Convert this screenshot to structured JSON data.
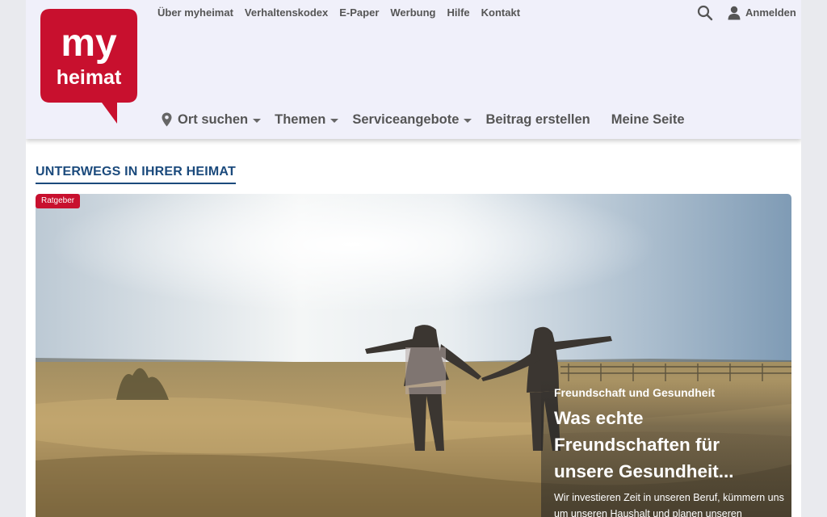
{
  "logo": {
    "line1": "my",
    "line2": "heimat",
    "color": "#c8102e"
  },
  "top_nav": {
    "links": [
      "Über myheimat",
      "Verhaltenskodex",
      "E-Paper",
      "Werbung",
      "Hilfe",
      "Kontakt"
    ],
    "search_icon": "search-icon",
    "login_label": "Anmelden",
    "login_icon": "user-icon"
  },
  "main_nav": {
    "location": {
      "label": "Ort suchen",
      "icon": "map-pin-icon"
    },
    "themes": "Themen",
    "services": "Serviceangebote",
    "create_post": "Beitrag erstellen",
    "my_page": "Meine Seite"
  },
  "section": {
    "title": "UNTERWEGS IN IHRER HEIMAT"
  },
  "hero": {
    "badge": "Ratgeber",
    "category": "Freundschaft und Gesundheit",
    "title": "Was echte Freundschaften für unsere Gesundheit...",
    "description": "Wir investieren Zeit in unseren Beruf, kümmern uns um unseren Haushalt und planen unseren"
  },
  "colors": {
    "brand_red": "#c8102e",
    "section_blue": "#1b4a7c",
    "header_bg": "#f0f0fa"
  }
}
